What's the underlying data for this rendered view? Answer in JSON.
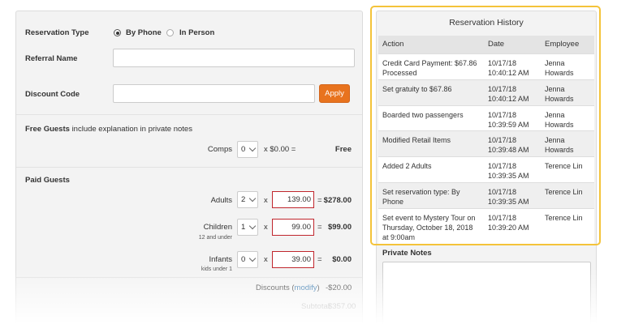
{
  "form": {
    "reservation_type": {
      "label": "Reservation Type",
      "options": [
        "By Phone",
        "In Person"
      ],
      "selected": "By Phone"
    },
    "referral": {
      "label": "Referral Name",
      "value": ""
    },
    "discount": {
      "label": "Discount Code",
      "value": "",
      "apply_label": "Apply"
    },
    "free_guests": {
      "title": "Free Guests",
      "hint": "include explanation in private notes",
      "comps_label": "Comps",
      "comps_qty": "0",
      "comps_price": "x $0.00 =",
      "comps_amount": "Free"
    },
    "paid_guests": {
      "title": "Paid Guests",
      "rows": [
        {
          "label": "Adults",
          "sub": "",
          "qty": "2",
          "x": "x",
          "price": "139.00",
          "eq": "=",
          "amount": "$278.00"
        },
        {
          "label": "Children",
          "sub": "12 and under",
          "qty": "1",
          "x": "x",
          "price": "99.00",
          "eq": "=",
          "amount": "$99.00"
        },
        {
          "label": "Infants",
          "sub": "kids under 1",
          "qty": "0",
          "x": "x",
          "price": "39.00",
          "eq": "=",
          "amount": "$0.00"
        }
      ]
    },
    "discounts": {
      "label": "Discounts",
      "link": "modify",
      "amount": "-$20.00"
    },
    "subtotal": {
      "label": "Subtotal",
      "amount": "$357.00"
    }
  },
  "history": {
    "title": "Reservation History",
    "columns": [
      "Action",
      "Date",
      "Employee"
    ],
    "rows": [
      {
        "action": "Credit Card Payment: $67.86 Processed",
        "date": "10/17/18 10:40:12 AM",
        "employee": "Jenna Howards"
      },
      {
        "action": "Set gratuity to $67.86",
        "date": "10/17/18 10:40:12 AM",
        "employee": "Jenna Howards"
      },
      {
        "action": "Boarded two passengers",
        "date": "10/17/18 10:39:59 AM",
        "employee": "Jenna Howards"
      },
      {
        "action": "Modified Retail Items",
        "date": "10/17/18 10:39:48 AM",
        "employee": "Jenna Howards"
      },
      {
        "action": "Added 2 Adults",
        "date": "10/17/18 10:39:35 AM",
        "employee": "Terence Lin"
      },
      {
        "action": "Set reservation type: By Phone",
        "date": "10/17/18 10:39:35 AM",
        "employee": "Terence Lin"
      },
      {
        "action": "Set event to Mystery Tour on Thursday, October 18, 2018 at 9:00am",
        "date": "10/17/18 10:39:20 AM",
        "employee": "Terence Lin"
      }
    ],
    "private_notes_label": "Private Notes"
  },
  "colors": {
    "accent": "#e8731e",
    "highlight": "#f4c33a",
    "error_border": "#c0262d",
    "link": "#2a6fa8"
  }
}
